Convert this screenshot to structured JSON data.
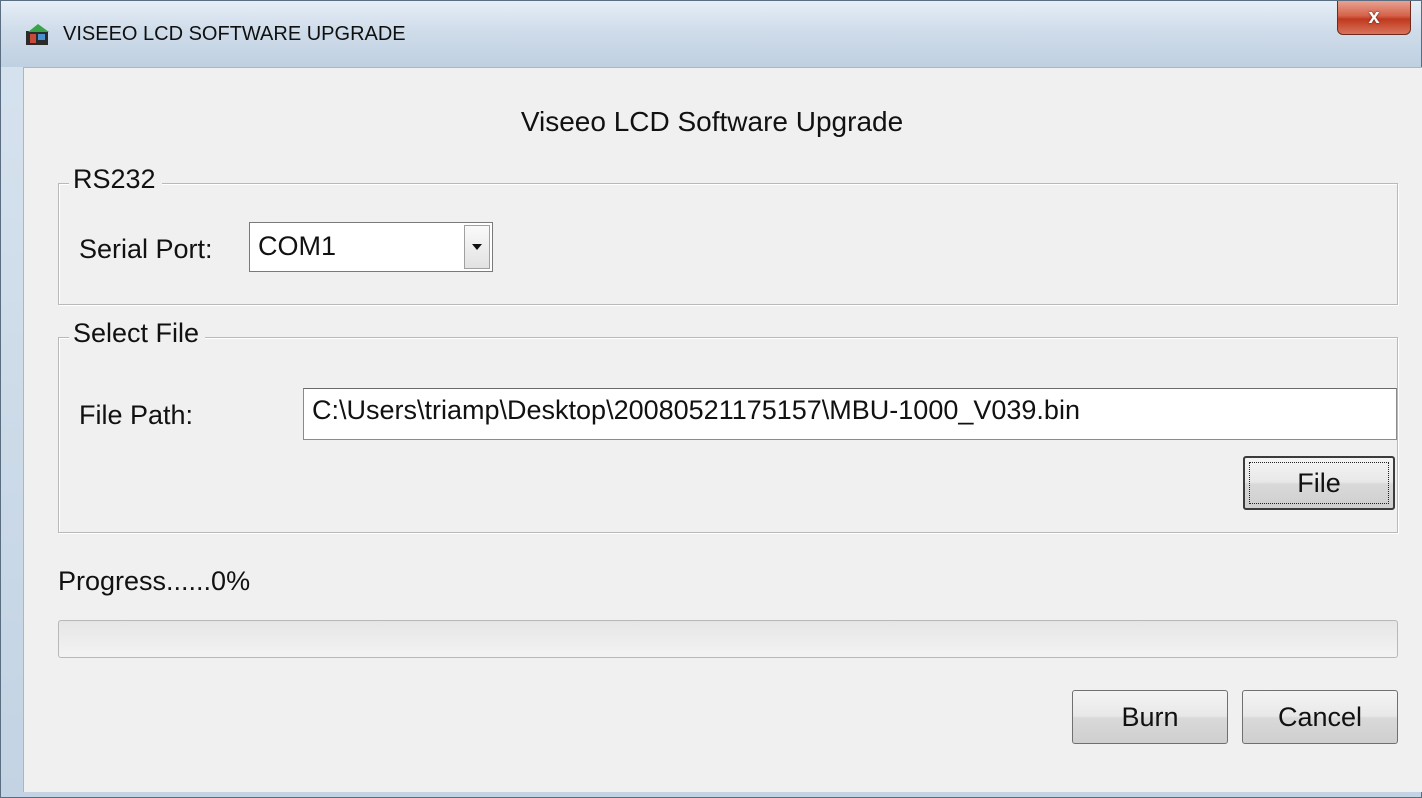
{
  "window": {
    "title": "VISEEO LCD SOFTWARE UPGRADE",
    "close_label": "x"
  },
  "dialog": {
    "heading": "Viseeo LCD Software Upgrade"
  },
  "rs232": {
    "group_label": "RS232",
    "serial_port_label": "Serial Port:",
    "serial_port_value": "COM1"
  },
  "select_file": {
    "group_label": "Select File",
    "file_path_label": "File Path:",
    "file_path_value": "C:\\Users\\triamp\\Desktop\\20080521175157\\MBU-1000_V039.bin",
    "file_button_label": "File"
  },
  "progress": {
    "label": "Progress......0%",
    "value_percent": 0,
    "fill_color": "#3fbd3f"
  },
  "actions": {
    "burn_label": "Burn",
    "cancel_label": "Cancel"
  },
  "icons": {
    "app_icon": "app-icon",
    "close_icon": "close-icon",
    "dropdown_icon": "chevron-down-icon"
  }
}
